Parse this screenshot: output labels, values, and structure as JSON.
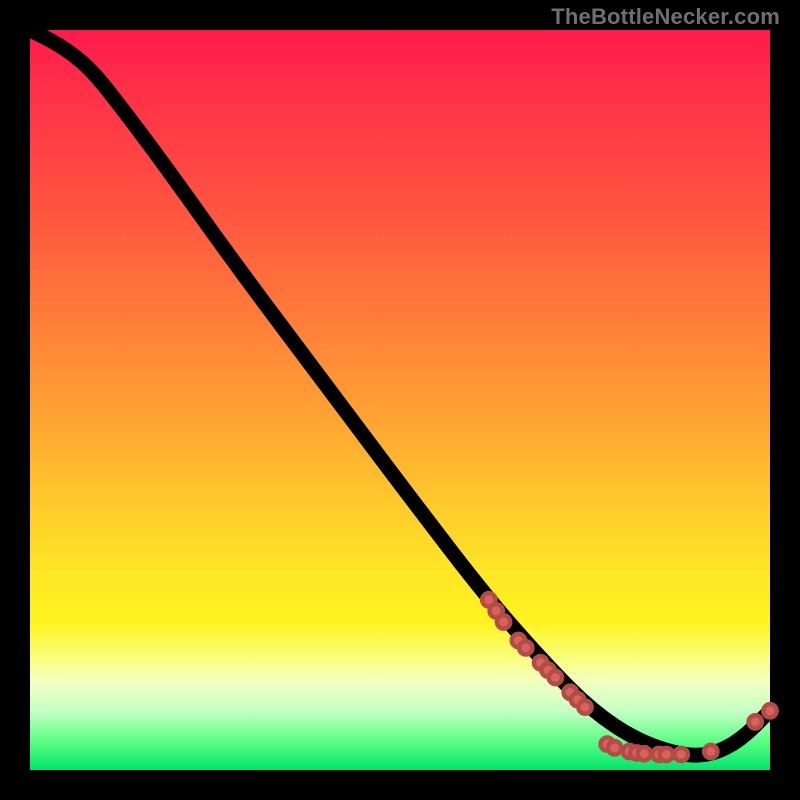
{
  "watermark": "TheBottleNecker.com",
  "chart_data": {
    "type": "line",
    "title": "",
    "xlabel": "",
    "ylabel": "",
    "xlim": [
      0,
      100
    ],
    "ylim": [
      0,
      100
    ],
    "series": [
      {
        "name": "curve",
        "x": [
          0,
          4,
          8,
          12,
          18,
          28,
          40,
          52,
          62,
          70,
          76,
          82,
          88,
          92,
          96,
          100
        ],
        "y": [
          100,
          98,
          95,
          90,
          82,
          68,
          52,
          36,
          23,
          14,
          8,
          4,
          2,
          2,
          4,
          8
        ]
      }
    ],
    "markers": [
      {
        "x": 62,
        "y": 23
      },
      {
        "x": 63,
        "y": 21.5
      },
      {
        "x": 64,
        "y": 20
      },
      {
        "x": 66,
        "y": 17.5
      },
      {
        "x": 67,
        "y": 16.5
      },
      {
        "x": 69,
        "y": 14.5
      },
      {
        "x": 70,
        "y": 13.5
      },
      {
        "x": 71,
        "y": 12.5
      },
      {
        "x": 73,
        "y": 10.5
      },
      {
        "x": 74,
        "y": 9.5
      },
      {
        "x": 75,
        "y": 8.5
      },
      {
        "x": 78,
        "y": 3.5
      },
      {
        "x": 79,
        "y": 3
      },
      {
        "x": 81,
        "y": 2.5
      },
      {
        "x": 82,
        "y": 2.3
      },
      {
        "x": 83,
        "y": 2.2
      },
      {
        "x": 85,
        "y": 2.1
      },
      {
        "x": 86,
        "y": 2.1
      },
      {
        "x": 88,
        "y": 2.1
      },
      {
        "x": 92,
        "y": 2.5
      },
      {
        "x": 98,
        "y": 6.5
      },
      {
        "x": 100,
        "y": 8
      }
    ],
    "gradient_stops": [
      {
        "pos": 0.0,
        "color": "#ff1a4b"
      },
      {
        "pos": 0.25,
        "color": "#ff5640"
      },
      {
        "pos": 0.52,
        "color": "#ffa233"
      },
      {
        "pos": 0.8,
        "color": "#fff31f"
      },
      {
        "pos": 0.92,
        "color": "#c6ffc6"
      },
      {
        "pos": 1.0,
        "color": "#00e56a"
      }
    ]
  }
}
